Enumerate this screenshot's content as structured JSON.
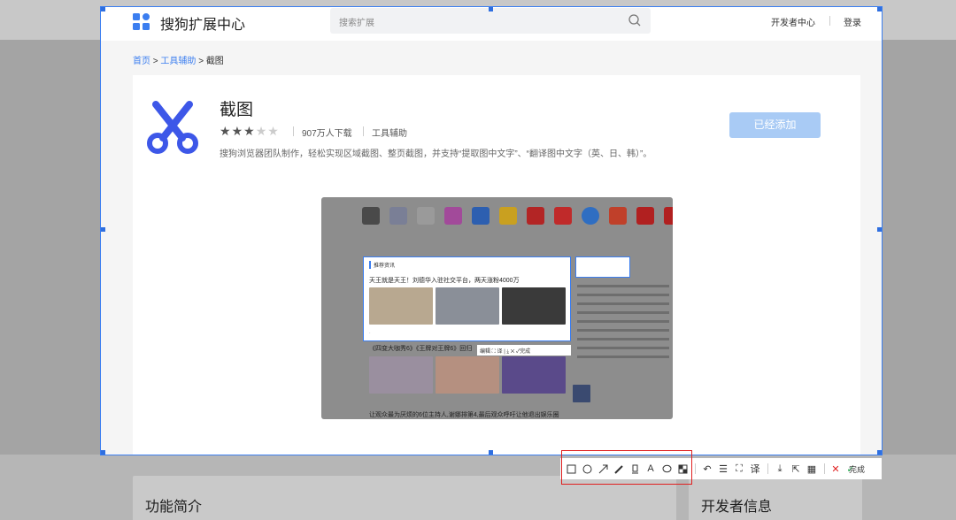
{
  "header": {
    "site_title": "搜狗扩展中心",
    "search_placeholder": "搜索扩展",
    "dev_center": "开发者中心",
    "login": "登录"
  },
  "breadcrumb": {
    "home": "首页",
    "category": "工具辅助",
    "current": "截图",
    "separator": ">"
  },
  "app": {
    "name": "截图",
    "rating": 3,
    "rating_max": 5,
    "downloads": "907万人下载",
    "category": "工具辅助",
    "description": "搜狗浏览器团队制作，轻松实现区域截图、整页截图，并支持“提取图中文字”、“翻译图中文字（英、日、韩）”。",
    "add_button": "已经添加"
  },
  "preview": {
    "panel_tag": "推荐资讯",
    "headline": "天王就是天王！刘德华入驻社交平台，两天涨粉4000万",
    "article_title": "《四变大咖秀6》《王牌对王牌6》回归",
    "bottom_text": "让观众最为厌烦的6位主持人,谢娜排第4,最后观众呼吁让他退出娱乐圈",
    "mini_toolbar": "编辑 ⛶ 译 | ⤓ ✕ ✓完成"
  },
  "sections": {
    "intro": "功能简介",
    "developer": "开发者信息"
  },
  "toolbar": {
    "done_label": "完成",
    "tools": [
      "rectangle-icon",
      "ellipse-icon",
      "arrow-icon",
      "pen-icon",
      "marker-icon",
      "text-icon",
      "bubble-icon",
      "mosaic-icon"
    ],
    "actions": [
      "undo-icon",
      "ocr-icon",
      "fullpage-icon",
      "translate-icon",
      "download-icon",
      "share-icon",
      "qrcode-icon",
      "cancel-icon"
    ]
  },
  "colors": {
    "accent": "#3b7ef0",
    "add_button": "#a9cbf5",
    "highlight": "#e02020"
  }
}
